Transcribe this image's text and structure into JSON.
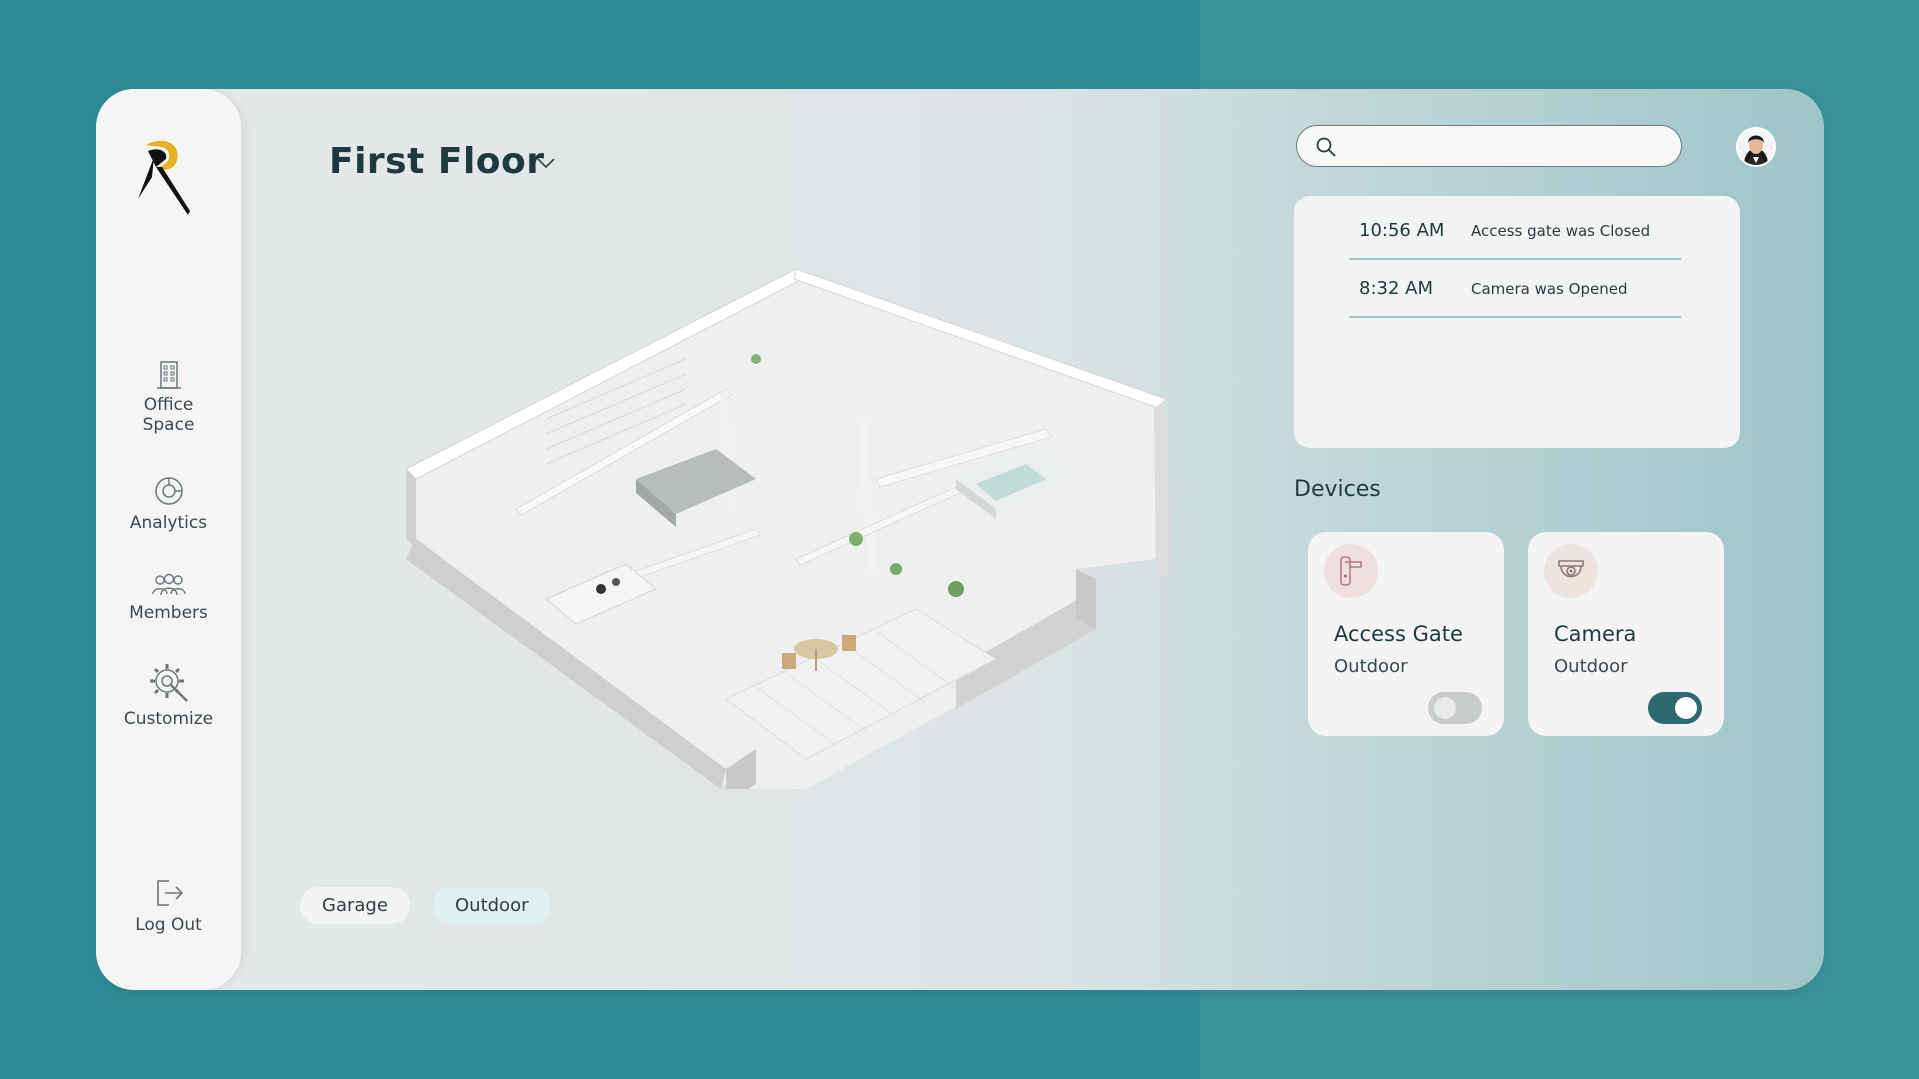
{
  "sidebar": {
    "logo": "brand-logo",
    "items": [
      {
        "label_line1": "Office",
        "label_line2": "Space",
        "icon": "building-icon"
      },
      {
        "label": "Analytics",
        "icon": "analytics-icon"
      },
      {
        "label": "Members",
        "icon": "members-icon"
      },
      {
        "label": "Customize",
        "icon": "gear-wrench-icon"
      }
    ],
    "logout": {
      "label": "Log Out",
      "icon": "logout-icon"
    }
  },
  "floor": {
    "title": "First Floor",
    "chevron": "chevron-down-icon"
  },
  "chips": [
    {
      "label": "Garage"
    },
    {
      "label": "Outdoor"
    }
  ],
  "search": {
    "placeholder": "",
    "icon": "search-icon"
  },
  "activity": [
    {
      "time": "10:56 AM",
      "text": "Access gate was Closed"
    },
    {
      "time": "8:32 AM",
      "text": "Camera was Opened"
    }
  ],
  "devices": {
    "title": "Devices",
    "items": [
      {
        "name": "Access Gate",
        "location": "Outdoor",
        "icon": "door-handle-icon",
        "enabled": false
      },
      {
        "name": "Camera",
        "location": "Outdoor",
        "icon": "security-camera-icon",
        "enabled": true
      }
    ]
  },
  "colors": {
    "accent": "#2e6a72",
    "background": "#2e8c96"
  }
}
